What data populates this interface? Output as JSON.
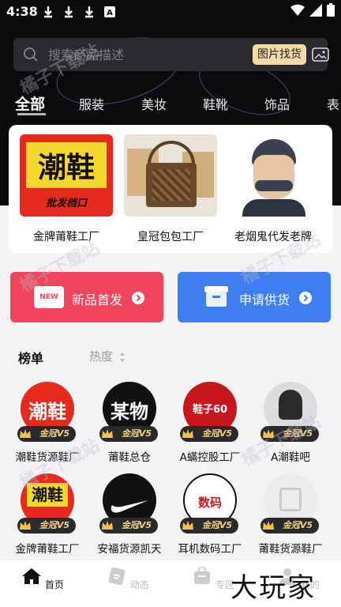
{
  "status_bar": {
    "time": "4:38",
    "icons": [
      "download-icon",
      "download-icon",
      "download-icon",
      "a-icon"
    ],
    "right_icons": [
      "wifi-icon",
      "signal-icon",
      "battery-icon"
    ]
  },
  "search": {
    "placeholder": "搜索商品描述",
    "image_search_label": "图片找货"
  },
  "categories": [
    "全部",
    "服装",
    "美妆",
    "鞋靴",
    "饰品",
    "表"
  ],
  "featured_shops": [
    {
      "name": "金牌莆鞋工厂",
      "logo_title": "潮鞋",
      "logo_sub": "批发档口"
    },
    {
      "name": "皇冠包包工厂"
    },
    {
      "name": "老烟鬼代发老牌"
    }
  ],
  "actions": {
    "new_label": "新品首发",
    "new_badge": "NEW",
    "supply_label": "申请供货"
  },
  "ranking": {
    "title": "榜单",
    "sort_label": "热度",
    "badge_text": "金冠V5"
  },
  "ranking_items": [
    {
      "name": "潮鞋货源鞋厂",
      "avatar_text": "潮鞋"
    },
    {
      "name": "莆鞋总仓",
      "avatar_text": "某物"
    },
    {
      "name": "A蟎控股工厂",
      "avatar_text": "鞋子60"
    },
    {
      "name": "A潮鞋吧",
      "avatar_text": ""
    },
    {
      "name": "金牌莆鞋工厂",
      "avatar_text": "潮鞋"
    },
    {
      "name": "安福货源凯天",
      "avatar_text": ""
    },
    {
      "name": "耳机数码工厂",
      "avatar_text": "数码"
    },
    {
      "name": "莆鞋货源鞋厂",
      "avatar_text": ""
    }
  ],
  "tabbar": [
    {
      "label": "首页"
    },
    {
      "label": "动态"
    },
    {
      "label": "专区"
    },
    {
      "label": "我的"
    }
  ],
  "watermark": "橘子下载站",
  "brand": "大玩家",
  "colors": {
    "accent_red": "#f0455a",
    "accent_blue": "#3f7ef0",
    "gold": "#f5d9a8"
  }
}
